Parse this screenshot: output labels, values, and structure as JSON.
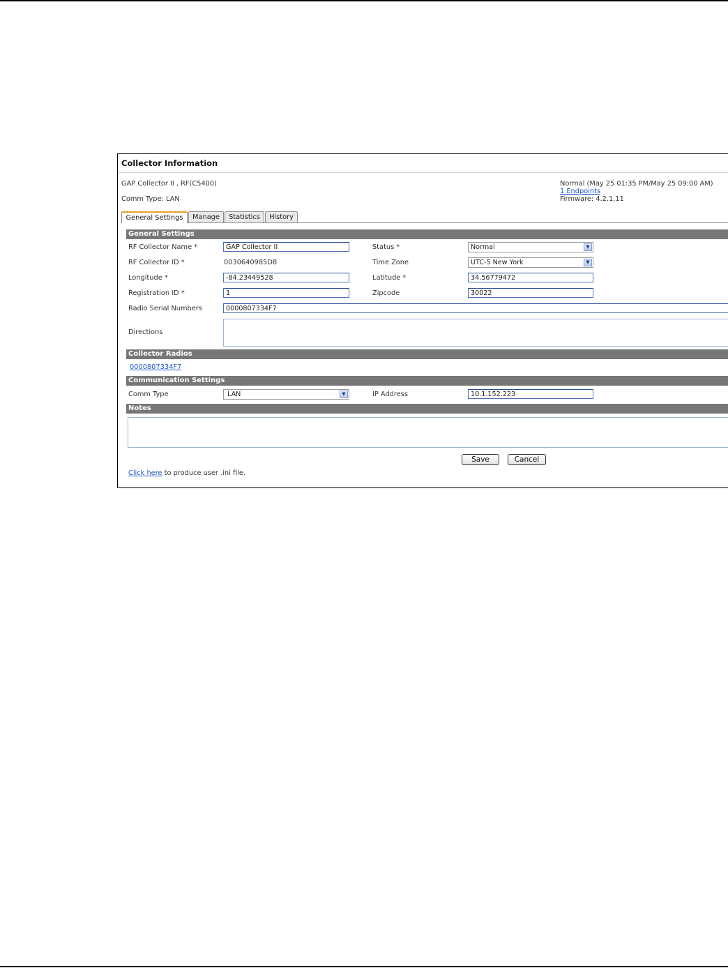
{
  "panel": {
    "title": "Collector Information",
    "collector_model": "GAP Collector II , RF(C5400)",
    "comm_type_line": "Comm Type: LAN",
    "status_line": "Normal (May 25 01:35 PM/May 25 09:00 AM)",
    "endpoints_link": "1 Endpoints",
    "firmware_line": "Firmware: 4.2.1.11"
  },
  "tabs": [
    {
      "label": "General Settings",
      "active": true
    },
    {
      "label": "Manage",
      "active": false
    },
    {
      "label": "Statistics",
      "active": false
    },
    {
      "label": "History",
      "active": false
    }
  ],
  "general": {
    "section_title": "General Settings",
    "name_label": "RF Collector Name *",
    "name_value": "GAP Collector II",
    "id_label": "RF Collector ID *",
    "id_value": "0030640985D8",
    "longitude_label": "Longitude *",
    "longitude_value": "-84.23449528",
    "registration_label": "Registration ID *",
    "registration_value": "1",
    "serial_label": "Radio Serial Numbers",
    "serial_value": "0000807334F7",
    "directions_label": "Directions",
    "directions_value": "",
    "status_label": "Status *",
    "status_value": "Normal",
    "timezone_label": "Time Zone",
    "timezone_value": "UTC-5 New York",
    "latitude_label": "Latitude *",
    "latitude_value": "34.56779472",
    "zipcode_label": "Zipcode",
    "zipcode_value": "30022"
  },
  "radios": {
    "section_title": "Collector Radios",
    "radio_link": "0000807334F7"
  },
  "communication": {
    "section_title": "Communication Settings",
    "comm_type_label": "Comm Type",
    "comm_type_value": "LAN",
    "ip_label": "IP Address",
    "ip_value": "10.1.152.223"
  },
  "notes": {
    "section_title": "Notes",
    "value": ""
  },
  "actions": {
    "save_label": "Save",
    "cancel_label": "Cancel"
  },
  "footer": {
    "link_text": "Click here",
    "suffix_text": " to produce user .ini file."
  },
  "icons": {
    "dropdown": "chevron-down-icon"
  },
  "colors": {
    "section_bar": "#777777",
    "active_tab_accent": "#e8a02a",
    "link": "#1a56c8"
  }
}
